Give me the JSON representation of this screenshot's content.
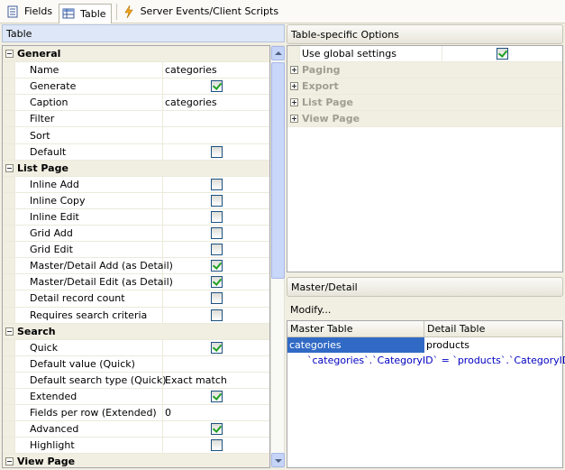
{
  "tabs": [
    {
      "label": "Fields",
      "icon": "fields-icon",
      "active": false
    },
    {
      "label": "Table",
      "icon": "table-icon",
      "active": true
    },
    {
      "label": "Server Events/Client Scripts",
      "icon": "lightning-icon",
      "active": false
    }
  ],
  "left_panel": {
    "title": "Table",
    "categories": {
      "general": "General",
      "list_page": "List Page",
      "search": "Search",
      "view_page": "View Page"
    },
    "rows": {
      "name": {
        "label": "Name",
        "value": "categories"
      },
      "generate": {
        "label": "Generate",
        "checked": true
      },
      "caption": {
        "label": "Caption",
        "value": "categories"
      },
      "filter": {
        "label": "Filter",
        "value": ""
      },
      "sort": {
        "label": "Sort",
        "value": ""
      },
      "default": {
        "label": "Default",
        "checked": false
      },
      "inline_add": {
        "label": "Inline Add",
        "checked": false
      },
      "inline_copy": {
        "label": "Inline Copy",
        "checked": false
      },
      "inline_edit": {
        "label": "Inline Edit",
        "checked": false
      },
      "grid_add": {
        "label": "Grid Add",
        "checked": false
      },
      "grid_edit": {
        "label": "Grid Edit",
        "checked": false
      },
      "md_add": {
        "label": "Master/Detail Add (as Detail)",
        "checked": true
      },
      "md_edit": {
        "label": "Master/Detail Edit (as Detail)",
        "checked": true
      },
      "detail_count": {
        "label": "Detail record count",
        "checked": false
      },
      "requires_search": {
        "label": "Requires search criteria",
        "checked": false
      },
      "quick": {
        "label": "Quick",
        "checked": true
      },
      "default_value_quick": {
        "label": "Default value (Quick)",
        "value": ""
      },
      "default_search_type": {
        "label": "Default search type (Quick)",
        "value": "Exact match"
      },
      "extended": {
        "label": "Extended",
        "checked": true
      },
      "fields_per_row": {
        "label": "Fields per row (Extended)",
        "value": "0"
      },
      "advanced": {
        "label": "Advanced",
        "checked": true
      },
      "highlight": {
        "label": "Highlight",
        "checked": false
      }
    }
  },
  "table_options": {
    "title": "Table-specific Options",
    "use_global": {
      "label": "Use global settings",
      "checked": true
    },
    "sections": [
      "Paging",
      "Export",
      "List Page",
      "View Page"
    ]
  },
  "master_detail": {
    "title": "Master/Detail",
    "modify_label": "Modify...",
    "columns": [
      "Master Table",
      "Detail Table"
    ],
    "master": "categories",
    "detail": "products",
    "relation": "`categories`.`CategoryID` = `products`.`CategoryID`"
  },
  "colors": {
    "accent": "#316ac5",
    "check": "#21a121",
    "header_blue": "#dde7f7"
  }
}
